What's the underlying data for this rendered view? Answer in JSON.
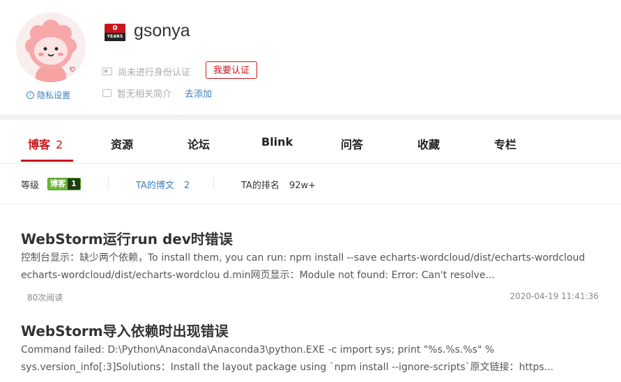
{
  "profile": {
    "username": "gsonya",
    "years_badge": {
      "number": "0",
      "label": "YEARS"
    },
    "privacy_link": "隐私设置",
    "id_status": "尚未进行身份认证",
    "verify_button": "我要认证",
    "bio_status": "暂无相关简介",
    "add_link": "去添加"
  },
  "tabs": [
    {
      "label": "博客",
      "count": "2",
      "active": true
    },
    {
      "label": "资源"
    },
    {
      "label": "论坛"
    },
    {
      "label": "Blink"
    },
    {
      "label": "问答"
    },
    {
      "label": "收藏"
    },
    {
      "label": "专栏"
    }
  ],
  "stats": {
    "level_label": "等级",
    "level_badge_text": "博客",
    "level_badge_num": "1",
    "posts_label": "TA的博文",
    "posts_count": "2",
    "rank_label": "TA的排名",
    "rank_value": "92w+"
  },
  "articles": [
    {
      "title": "WebStorm运行run dev时错误",
      "desc_line1": "控制台显示：缺少两个依赖，To install them, you can run: npm install --save echarts-wordcloud/dist/echarts-wordcloud",
      "desc_line2": "echarts-wordcloud/dist/echarts-wordclou d.min网页显示：Module not found: Error: Can't resolve...",
      "reads": "80次阅读",
      "date": "2020-04-19 11:41:36"
    },
    {
      "title": "WebStorm导入依赖时出现错误",
      "desc_line1": "Command failed: D:\\Python\\Anaconda\\Anaconda3\\python.EXE -c import sys; print \"%s.%s.%s\" %",
      "desc_line2": "sys.version_info[:3]Solutions：Install the layout package using `npm install --ignore-scripts`原文链接：https..."
    }
  ],
  "colors": {
    "brand_red": "#c9161d",
    "link_blue": "#3d7fc0",
    "badge_green": "#6fb53f"
  }
}
